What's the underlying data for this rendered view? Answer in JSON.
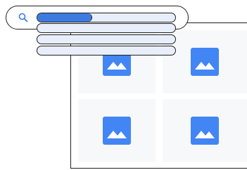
{
  "search": {
    "icon": "search-icon",
    "query_progress": 0.4
  },
  "results": {
    "placeholder_icon": "image-icon",
    "tile_count": 4
  },
  "colors": {
    "accent": "#3d7be0",
    "icon_blue": "#4285f4",
    "tile_bg": "#f7f8fa",
    "bar_bg": "#e8eefa",
    "outline": "#1f1f1f"
  }
}
